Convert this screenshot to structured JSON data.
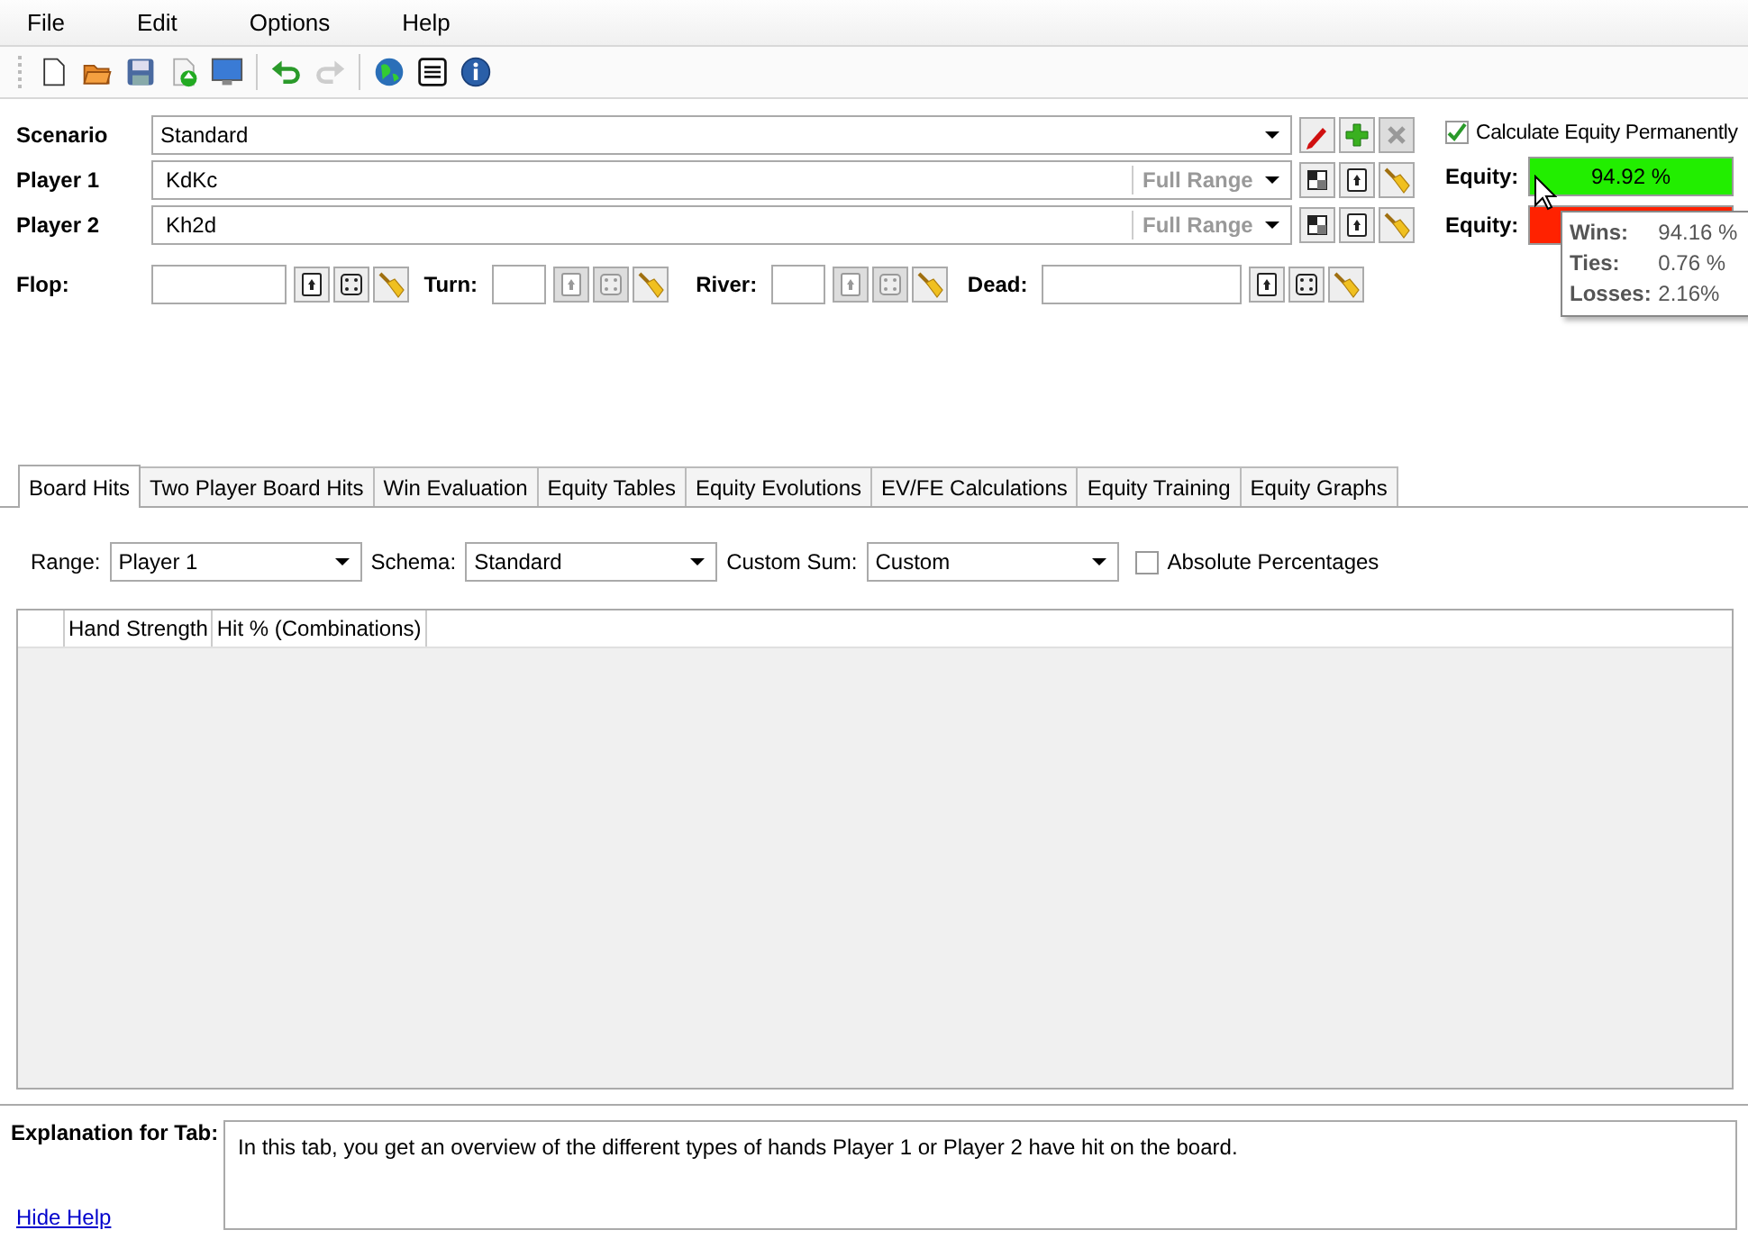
{
  "menu": [
    "File",
    "Edit",
    "Options",
    "Help"
  ],
  "toolbar": [
    [
      {
        "kind": "new",
        "disabled": false
      },
      {
        "kind": "open",
        "disabled": false
      },
      {
        "kind": "save",
        "disabled": false
      },
      {
        "kind": "export",
        "disabled": false
      },
      {
        "kind": "monitor",
        "disabled": false
      }
    ],
    [
      {
        "kind": "undo",
        "disabled": false
      },
      {
        "kind": "redo",
        "disabled": true
      }
    ],
    [
      {
        "kind": "globe",
        "disabled": false
      },
      {
        "kind": "list",
        "disabled": false
      },
      {
        "kind": "info",
        "disabled": false
      }
    ]
  ],
  "scenario": {
    "label": "Scenario",
    "value": "Standard",
    "buttons": [
      {
        "kind": "edit",
        "disabled": false
      },
      {
        "kind": "add",
        "disabled": false
      },
      {
        "kind": "delete",
        "disabled": true
      }
    ]
  },
  "calc_permanent": {
    "label": "Calculate Equity Permanently",
    "checked": true
  },
  "players": [
    {
      "label": "Player 1",
      "hand": "KdKc",
      "range": "Full Range",
      "equity_label": "Equity:",
      "equity": "94.92 %",
      "color": "#22ee00",
      "buttons": [
        {
          "kind": "matrix",
          "disabled": false
        },
        {
          "kind": "card",
          "disabled": false
        },
        {
          "kind": "broom",
          "disabled": false
        }
      ]
    },
    {
      "label": "Player 2",
      "hand": "Kh2d",
      "range": "Full Range",
      "equity_label": "Equity:",
      "color": "#ff2200",
      "buttons": [
        {
          "kind": "matrix",
          "disabled": false
        },
        {
          "kind": "card",
          "disabled": false
        },
        {
          "kind": "broom",
          "disabled": false
        }
      ]
    }
  ],
  "board": [
    {
      "label": "Flop:",
      "buttons": [
        {
          "kind": "card",
          "disabled": false
        },
        {
          "kind": "dice",
          "disabled": false
        },
        {
          "kind": "broom",
          "disabled": false
        }
      ]
    },
    {
      "label": "Turn:",
      "buttons": [
        {
          "kind": "card",
          "disabled": true
        },
        {
          "kind": "dice",
          "disabled": true
        },
        {
          "kind": "broom",
          "disabled": false
        }
      ]
    },
    {
      "label": "River:",
      "buttons": [
        {
          "kind": "card",
          "disabled": true
        },
        {
          "kind": "dice",
          "disabled": true
        },
        {
          "kind": "broom",
          "disabled": false
        }
      ]
    },
    {
      "label": "Dead:",
      "buttons": [
        {
          "kind": "card",
          "disabled": false
        },
        {
          "kind": "dice",
          "disabled": false
        },
        {
          "kind": "broom",
          "disabled": false
        }
      ]
    }
  ],
  "tooltip": [
    {
      "label": "Wins:",
      "value": "94.16 %"
    },
    {
      "label": "Ties:",
      "value": "0.76 %"
    },
    {
      "label": "Losses:",
      "value": "2.16%"
    }
  ],
  "tabs": [
    {
      "label": "Board Hits",
      "selected": true
    },
    {
      "label": "Two Player Board Hits",
      "selected": false
    },
    {
      "label": "Win Evaluation",
      "selected": false
    },
    {
      "label": "Equity Tables",
      "selected": false
    },
    {
      "label": "Equity Evolutions",
      "selected": false
    },
    {
      "label": "EV/FE Calculations",
      "selected": false
    },
    {
      "label": "Equity Training",
      "selected": false
    },
    {
      "label": "Equity Graphs",
      "selected": false
    }
  ],
  "filters": [
    {
      "label": "Range:",
      "value": "Player 1"
    },
    {
      "label": "Schema:",
      "value": "Standard"
    },
    {
      "label": "Custom Sum:",
      "value": "Custom"
    }
  ],
  "absolute_percentages": {
    "label": "Absolute Percentages",
    "checked": false
  },
  "table": {
    "columns": [
      "Hand Strength",
      "Hit % (Combinations)"
    ]
  },
  "help": {
    "label": "Explanation for Tab:",
    "text": "In this tab, you get an overview of the different types of hands Player 1 or Player 2 have hit on the board.",
    "link": "Hide Help"
  }
}
